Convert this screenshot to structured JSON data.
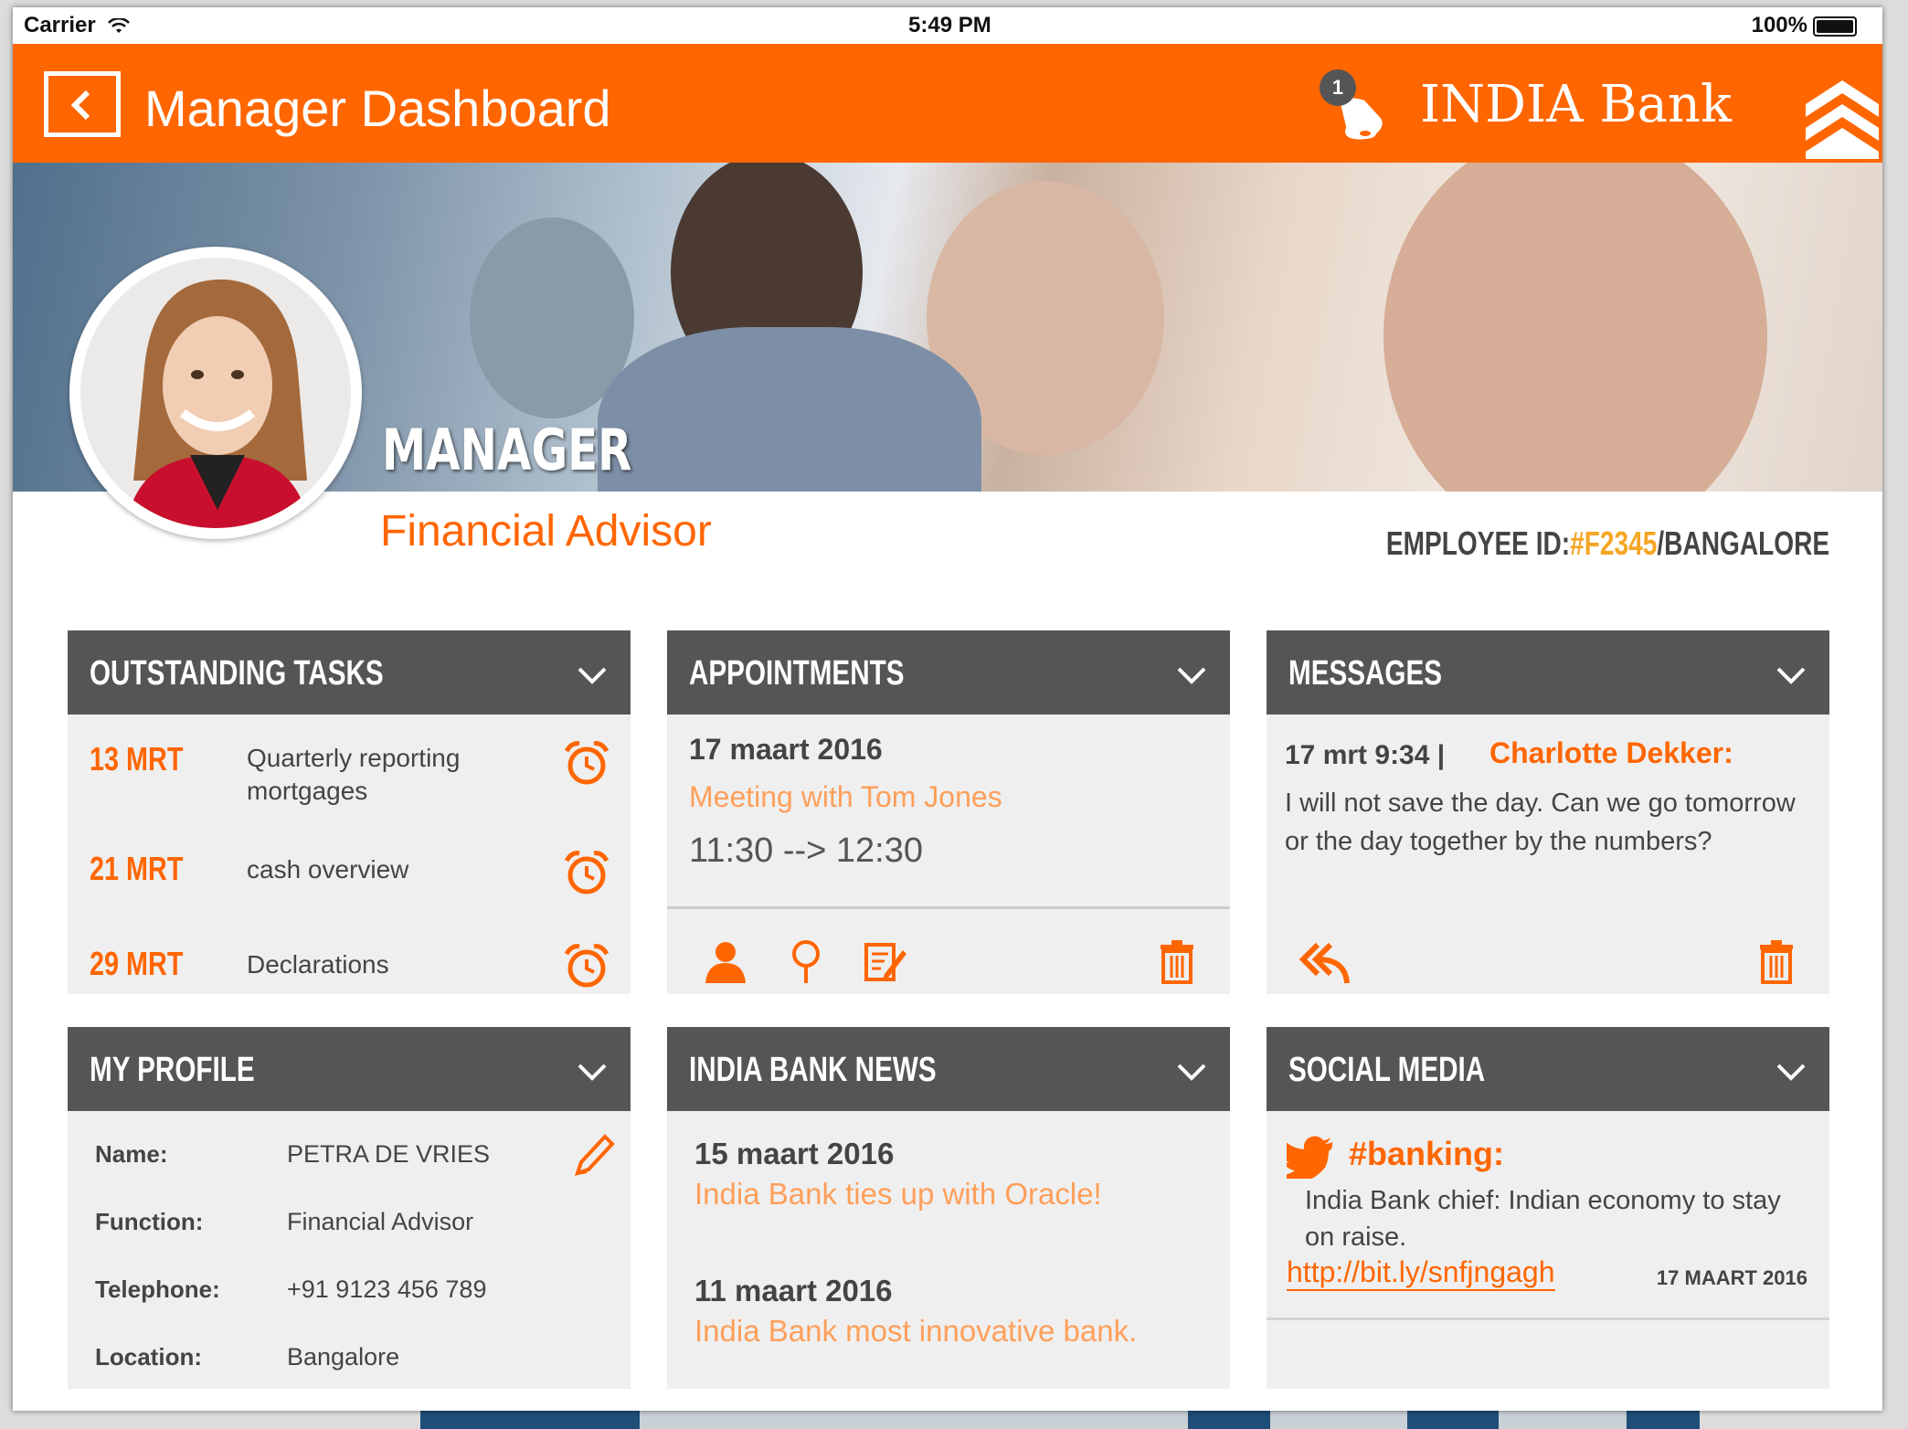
{
  "status_bar": {
    "carrier": "Carrier",
    "time": "5:49 PM",
    "battery": "100%"
  },
  "header": {
    "title": "Manager Dashboard",
    "notification_count": "1",
    "brand": "INDIA Bank"
  },
  "profile_banner": {
    "role": "MANAGER",
    "subtitle": "Financial Advisor",
    "employee_id_label": "EMPLOYEE ID:",
    "employee_id": "#F2345",
    "employee_location": "/BANGALORE"
  },
  "outstanding_tasks": {
    "title": "OUTSTANDING TASKS",
    "items": [
      {
        "date": "13 MRT",
        "text": "Quarterly reporting mortgages"
      },
      {
        "date": "21 MRT",
        "text": "cash overview"
      },
      {
        "date": "29 MRT",
        "text": "Declarations"
      }
    ]
  },
  "appointments": {
    "title": "APPOINTMENTS",
    "date": "17 maart 2016",
    "subject": "Meeting with Tom Jones",
    "time": "11:30 --> 12:30"
  },
  "messages": {
    "title": "MESSAGES",
    "time": "17 mrt 9:34 |",
    "from": "Charlotte Dekker:",
    "body": "I will not save the day. Can we go tomorrow or the day together by the numbers?"
  },
  "my_profile": {
    "title": "MY PROFILE",
    "fields": [
      {
        "label": "Name:",
        "value": "PETRA DE VRIES"
      },
      {
        "label": "Function:",
        "value": "Financial Advisor"
      },
      {
        "label": "Telephone:",
        "value": "+91 9123 456 789"
      },
      {
        "label": "Location:",
        "value": "Bangalore"
      }
    ]
  },
  "news": {
    "title": "INDIA BANK NEWS",
    "items": [
      {
        "date": "15 maart 2016",
        "title": "India Bank ties up with Oracle!"
      },
      {
        "date": "11 maart 2016",
        "title": "India Bank most innovative bank."
      }
    ]
  },
  "social_media": {
    "title": "SOCIAL MEDIA",
    "tag": "#banking:",
    "text": "India Bank chief: Indian economy to stay on raise.",
    "link": "http://bit.ly/snfjngagh",
    "date": "17 MAART 2016"
  },
  "colors": {
    "accent": "#ff6600",
    "card_header": "#555555",
    "card_body": "#efefef",
    "highlight": "#f5a623"
  }
}
